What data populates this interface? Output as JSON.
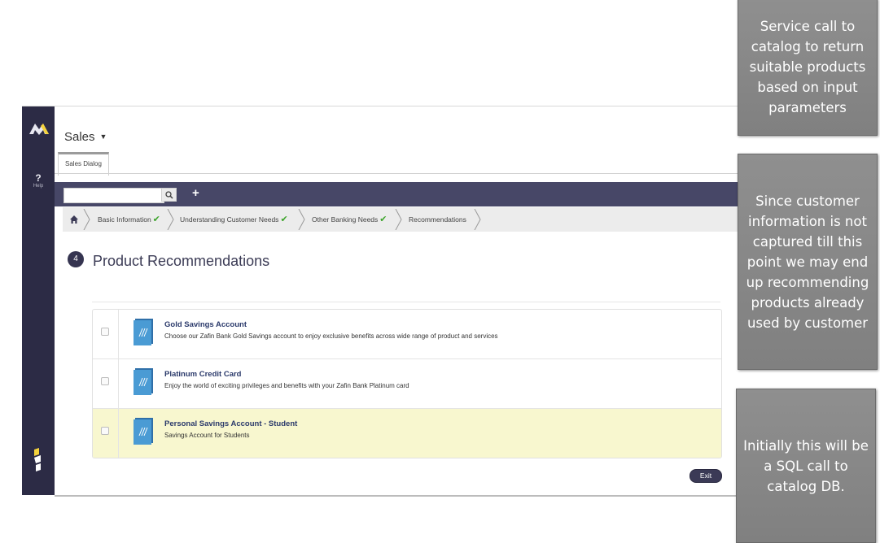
{
  "app": {
    "title": "Sales",
    "tab": "Sales Dialog",
    "help_label": "Help"
  },
  "toolbar": {
    "search_value": "",
    "search_icon": "search-icon",
    "add_icon": "plus-icon"
  },
  "breadcrumb": {
    "home_icon": "home-icon",
    "steps": [
      {
        "label": "Basic Information",
        "done": true
      },
      {
        "label": "Understanding Customer Needs",
        "done": true
      },
      {
        "label": "Other Banking Needs",
        "done": true
      },
      {
        "label": "Recommendations",
        "done": false
      }
    ],
    "check_color": "#3ea52c"
  },
  "page": {
    "step_number": "4",
    "title": "Product Recommendations"
  },
  "products": [
    {
      "name": "Gold Savings Account",
      "description": "Choose our Zafin Bank Gold Savings account to enjoy exclusive benefits across wide range of product and services",
      "highlighted": false,
      "checked": false
    },
    {
      "name": "Platinum Credit Card",
      "description": "Enjoy the world of exciting privileges and benefits with your Zafin Bank Platinum card",
      "highlighted": false,
      "checked": false
    },
    {
      "name": "Personal Savings Account - Student",
      "description": "Savings Account for Students",
      "highlighted": true,
      "checked": false
    }
  ],
  "actions": {
    "exit_label": "Exit"
  },
  "callouts": [
    "Service call to catalog to return suitable products based on input parameters",
    "Since customer information is not captured till this point we may end up recommending products already used by customer",
    "Initially this will be a SQL call to catalog DB."
  ],
  "colors": {
    "rail": "#2c2b45",
    "toolbar": "#474767",
    "highlight_row": "#f8f7cf",
    "callout": "#888888"
  }
}
